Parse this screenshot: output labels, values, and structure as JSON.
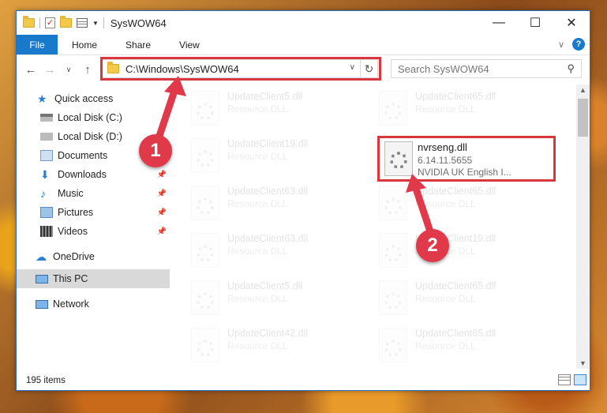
{
  "window": {
    "title": "SysWOW64",
    "controls": {
      "minimize": "—",
      "maximize": "☐",
      "close": "✕"
    }
  },
  "ribbon": {
    "tabs": [
      {
        "label": "File"
      },
      {
        "label": "Home"
      },
      {
        "label": "Share"
      },
      {
        "label": "View"
      }
    ],
    "expand_icon": "chevron-down-icon",
    "help_label": "?"
  },
  "address": {
    "path": "C:\\Windows\\SysWOW64",
    "search_placeholder": "Search SysWOW64"
  },
  "nav_pane": {
    "items": [
      {
        "label": "Quick access",
        "icon": "star-icon"
      },
      {
        "label": "Local Disk (C:)",
        "icon": "drive-icon"
      },
      {
        "label": "Local Disk (D:)",
        "icon": "drive-icon"
      },
      {
        "label": "Documents",
        "icon": "documents-icon"
      },
      {
        "label": "Downloads",
        "icon": "download-icon"
      },
      {
        "label": "Music",
        "icon": "music-icon"
      },
      {
        "label": "Pictures",
        "icon": "pictures-icon"
      },
      {
        "label": "Videos",
        "icon": "videos-icon"
      },
      {
        "label": "OneDrive",
        "icon": "cloud-icon"
      },
      {
        "label": "This PC",
        "icon": "computer-icon"
      },
      {
        "label": "Network",
        "icon": "network-icon"
      }
    ]
  },
  "files": {
    "left": [
      {
        "name": "UpdateClient5.dll",
        "type": "Resource DLL"
      },
      {
        "name": "UpdateClient19.dll",
        "type": "Resource DLL"
      },
      {
        "name": "UpdateClient63.dll",
        "type": "Resource DLL"
      },
      {
        "name": "UpdateClient63.dll",
        "type": "Resource DLL"
      },
      {
        "name": "UpdateClient5.dll",
        "type": "Resource DLL"
      },
      {
        "name": "UpdateClient42.dll",
        "type": "Resource DLL"
      }
    ],
    "right": [
      {
        "name": "UpdateClient65.dll",
        "type": "Resource DLL"
      },
      {
        "name": "UpdateClient65.dll",
        "type": "Resource DLL"
      },
      {
        "name": "UpdateClient19.dll",
        "type": "Resource DLL"
      },
      {
        "name": "UpdateClient65.dll",
        "type": "Resource DLL"
      },
      {
        "name": "UpdateClient65.dll",
        "type": "Resource DLL"
      }
    ],
    "highlighted": {
      "name": "nvrseng.dll",
      "version": "6.14.11.5655",
      "description": "NVIDIA UK English I..."
    }
  },
  "status": {
    "item_count": "195 items"
  },
  "callouts": {
    "one": "1",
    "two": "2"
  },
  "colors": {
    "accent": "#1979ca",
    "highlight": "#d9363e",
    "callout": "#e0394a"
  }
}
